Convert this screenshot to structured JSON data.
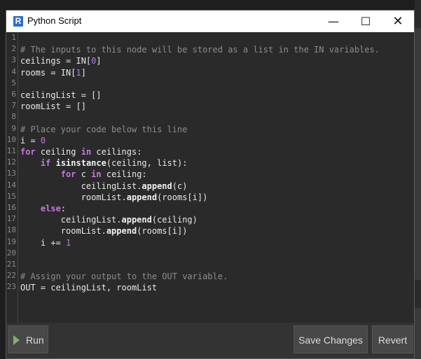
{
  "window": {
    "title": "Python Script",
    "app_icon_letter": "R",
    "controls": {
      "minimize": "—",
      "maximize": "☐",
      "close": "✕"
    }
  },
  "editor": {
    "line_numbers": [
      "1",
      "2",
      "3",
      "4",
      "5",
      "6",
      "7",
      "8",
      "9",
      "10",
      "11",
      "12",
      "13",
      "14",
      "15",
      "16",
      "17",
      "18",
      "19",
      "20",
      "21",
      "22",
      "23"
    ],
    "lines": [
      "",
      "# The inputs to this node will be stored as a list in the IN variables.",
      "ceilings = IN[0]",
      "rooms = IN[1]",
      "",
      "ceilingList = []",
      "roomList = []",
      "",
      "# Place your code below this line",
      "i = 0",
      "for ceiling in ceilings:",
      "    if isinstance(ceiling, list):",
      "        for c in ceiling:",
      "            ceilingList.append(c)",
      "            roomList.append(rooms[i])",
      "    else:",
      "        ceilingList.append(ceiling)",
      "        roomList.append(rooms[i])",
      "    i += 1",
      "",
      "",
      "# Assign your output to the OUT variable.",
      "OUT = ceilingList, roomList"
    ]
  },
  "buttons": {
    "run": "Run",
    "save_changes": "Save Changes",
    "revert": "Revert"
  }
}
